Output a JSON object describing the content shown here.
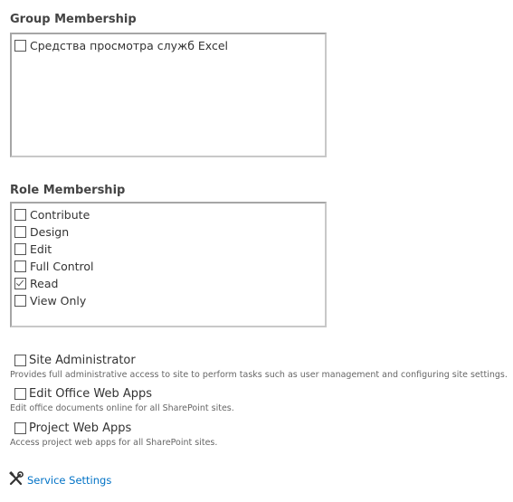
{
  "group_membership": {
    "title": "Group Membership",
    "items": [
      {
        "label": "Средства просмотра служб Excel",
        "checked": false
      }
    ]
  },
  "role_membership": {
    "title": "Role Membership",
    "items": [
      {
        "label": "Contribute",
        "checked": false
      },
      {
        "label": "Design",
        "checked": false
      },
      {
        "label": "Edit",
        "checked": false
      },
      {
        "label": "Full Control",
        "checked": false
      },
      {
        "label": "Read",
        "checked": true
      },
      {
        "label": "View Only",
        "checked": false
      }
    ]
  },
  "permissions": [
    {
      "label": "Site Administrator",
      "checked": false,
      "description": "Provides full administrative access to site to perform tasks such as user management and configuring site settings."
    },
    {
      "label": "Edit Office Web Apps",
      "checked": false,
      "description": "Edit office documents online for all SharePoint sites."
    },
    {
      "label": "Project Web Apps",
      "checked": false,
      "description": "Access project web apps for all SharePoint sites."
    }
  ],
  "service_settings": {
    "icon": "tools-icon",
    "label": "Service Settings"
  },
  "colors": {
    "link": "#0072c6",
    "text": "#444444",
    "border": "#a6a6a6"
  }
}
